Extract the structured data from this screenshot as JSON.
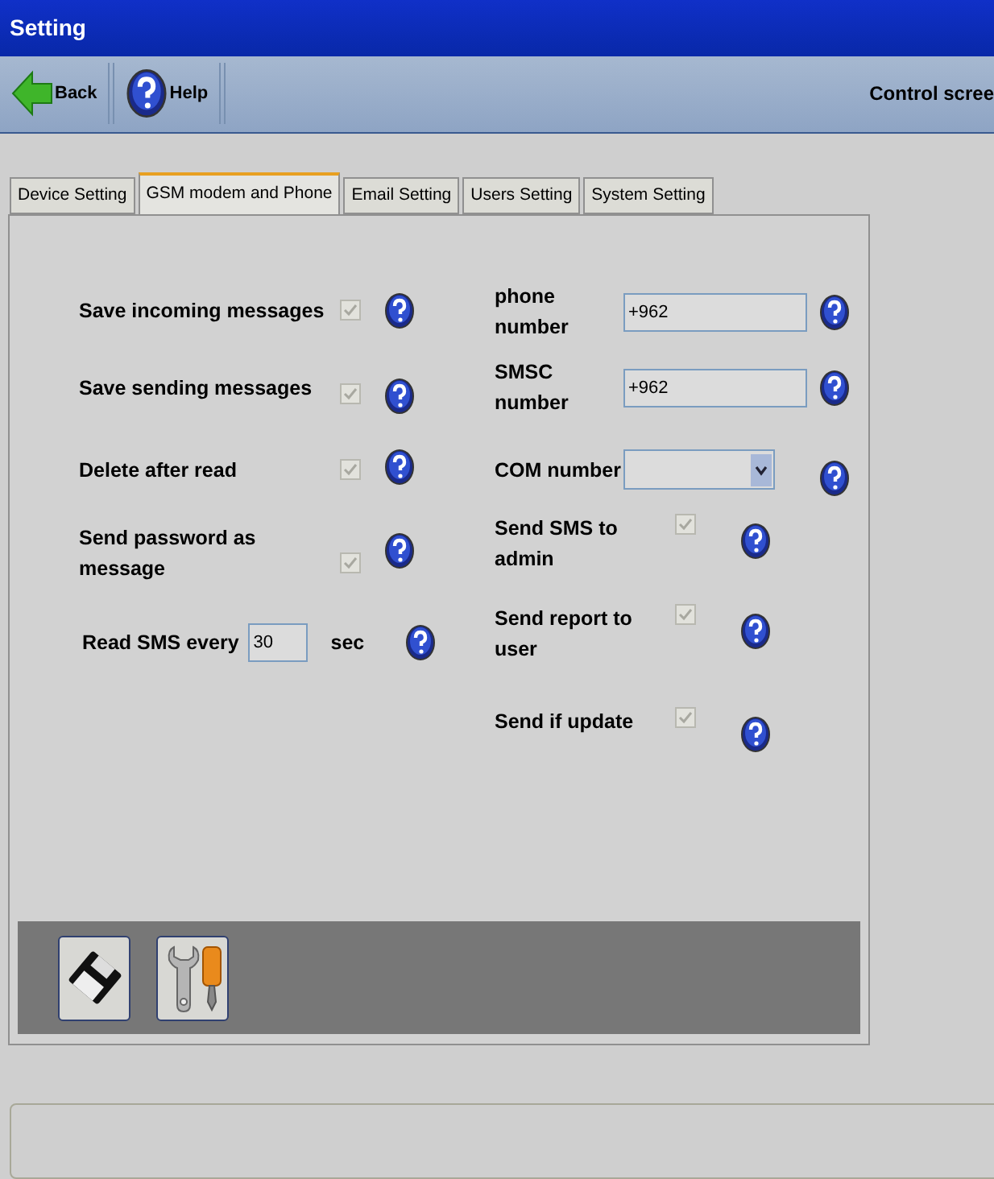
{
  "window": {
    "title": "Setting"
  },
  "toolbar": {
    "buttons": [
      {
        "kind": "back",
        "label": "Back"
      },
      {
        "kind": "help",
        "label": "Help"
      }
    ],
    "screen_title": "Control scree"
  },
  "tabs": [
    {
      "label": "Device Setting",
      "selected": false
    },
    {
      "label": "GSM modem and Phone",
      "selected": true
    },
    {
      "label": "Email Setting",
      "selected": false
    },
    {
      "label": "Users Setting",
      "selected": false
    },
    {
      "label": "System Setting",
      "selected": false
    }
  ],
  "left_settings": [
    {
      "kind": "checkbox",
      "label": "Save incoming messages",
      "checked": true
    },
    {
      "kind": "checkbox",
      "label": "Save sending messages",
      "checked": true
    },
    {
      "kind": "checkbox",
      "label": "Delete after read",
      "checked": true
    },
    {
      "kind": "checkbox",
      "label": "Send password as message",
      "checked": true
    },
    {
      "kind": "interval",
      "label": "Read SMS every",
      "value": "30",
      "unit": "sec"
    }
  ],
  "right_settings": [
    {
      "kind": "field",
      "label": "phone number",
      "value": "+962"
    },
    {
      "kind": "field",
      "label": "SMSC number",
      "value": "+962"
    },
    {
      "kind": "select",
      "label": "COM number"
    },
    {
      "kind": "checkbox",
      "label": "Send SMS to admin",
      "checked": true
    },
    {
      "kind": "checkbox",
      "label": "Send report to user",
      "checked": true
    },
    {
      "kind": "checkbox",
      "label": "Send if update",
      "checked": true
    }
  ],
  "footer_buttons": [
    {
      "kind": "save"
    },
    {
      "kind": "tools"
    }
  ]
}
